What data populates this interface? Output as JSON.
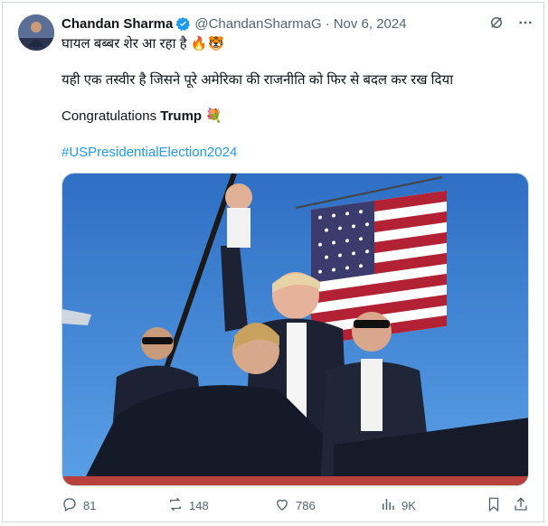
{
  "tweet": {
    "author_name": "Chandan Sharma",
    "author_handle": "@ChandanSharmaG",
    "separator": "·",
    "date": "Nov 6, 2024",
    "line1": "घायल बब्बर शेर आ रहा है 🔥🐯",
    "line2": "यही एक तस्वीर है जिसने पूरे अमेरिका की राजनीति को फिर से बदल कर रख दिया",
    "line3_prefix": "Congratulations ",
    "line3_bold": "Trump",
    "line3_suffix": " 💐",
    "hashtag": "#USPresidentialElection2024"
  },
  "actions": {
    "replies": "81",
    "reposts": "148",
    "likes": "786",
    "views": "9K"
  },
  "icons": {
    "verified": "verified-badge-icon",
    "grok": "grok-icon",
    "more": "more-icon",
    "reply": "reply-icon",
    "repost": "repost-icon",
    "like": "heart-icon",
    "views": "views-icon",
    "bookmark": "bookmark-icon",
    "share": "share-icon"
  },
  "colors": {
    "accent": "#1d9bf0",
    "muted": "#536471",
    "text": "#0f1419",
    "border": "#cfd9de"
  }
}
